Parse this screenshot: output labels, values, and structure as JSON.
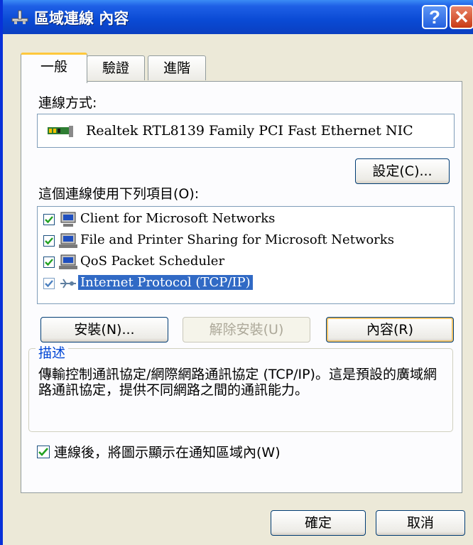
{
  "window": {
    "title": "區域連線 內容",
    "help_label": "?",
    "close_label": "✕"
  },
  "tabs": [
    {
      "label": "一般",
      "active": true
    },
    {
      "label": "驗證",
      "active": false
    },
    {
      "label": "進階",
      "active": false
    }
  ],
  "connect_using": {
    "label": "連線方式:",
    "adapter": "Realtek RTL8139 Family PCI Fast Ethernet NIC"
  },
  "configure_button": "設定(C)...",
  "items_label": "這個連線使用下列項目(O):",
  "items": [
    {
      "label": "Client for Microsoft Networks",
      "checked": true,
      "selected": false,
      "icon": "network-client-icon"
    },
    {
      "label": "File and Printer Sharing for Microsoft Networks",
      "checked": true,
      "selected": false,
      "icon": "network-service-icon"
    },
    {
      "label": "QoS Packet Scheduler",
      "checked": true,
      "selected": false,
      "icon": "network-service-icon"
    },
    {
      "label": "Internet Protocol (TCP/IP)",
      "checked": true,
      "selected": true,
      "icon": "network-protocol-icon"
    }
  ],
  "buttons": {
    "install": "安裝(N)...",
    "uninstall": "解除安裝(U)",
    "properties": "內容(R)",
    "ok": "確定",
    "cancel": "取消"
  },
  "description": {
    "legend": "描述",
    "text": "傳輸控制通訊協定/網際網路通訊協定 (TCP/IP)。這是預設的廣域網路通訊協定，提供不同網路之間的通訊能力。"
  },
  "tray_option": {
    "label": "連線後，將圖示顯示在通知區域內(W)",
    "checked": true
  },
  "colors": {
    "titlebar": "#0a4ad4",
    "selection": "#316ac5",
    "legend": "#0046d5",
    "panel": "#fcfcfe",
    "dialog": "#ece9d8"
  }
}
